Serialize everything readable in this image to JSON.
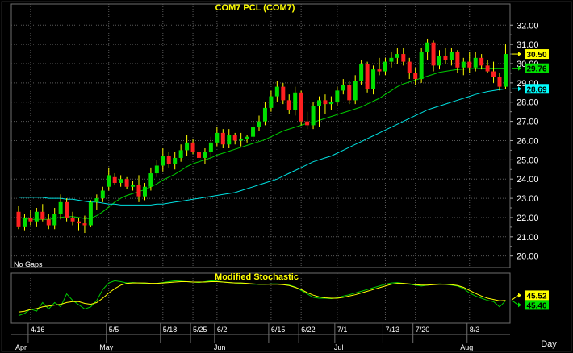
{
  "chart_data": [
    {
      "type": "candlestick",
      "title": "COM7  PCL  (COM7)",
      "annotation": "No  Gaps",
      "ylim": [
        19.4,
        33.1
      ],
      "yticks": [
        "20.00",
        "21.00",
        "22.00",
        "23.00",
        "24.00",
        "25.00",
        "26.00",
        "27.00",
        "28.00",
        "29.00",
        "30.00",
        "31.00",
        "32.00"
      ],
      "last_values": [
        {
          "label": "30.50",
          "value": 30.5,
          "color": "#ffff00"
        },
        {
          "label": "29.76",
          "value": 29.76,
          "color": "#00e000"
        },
        {
          "label": "28.69",
          "value": 28.69,
          "color": "#00ffff"
        }
      ],
      "series": [
        {
          "kind": "ohlc",
          "up_color": "#00e000",
          "down_color": "#ff2020",
          "wick_color": "#ffff00",
          "ohlc": [
            [
              22.3,
              22.6,
              21.4,
              21.5
            ],
            [
              21.5,
              22.2,
              21.3,
              22.0
            ],
            [
              22.0,
              22.4,
              21.6,
              21.8
            ],
            [
              21.8,
              22.5,
              21.5,
              22.3
            ],
            [
              22.3,
              22.7,
              21.8,
              21.9
            ],
            [
              21.9,
              22.2,
              21.4,
              21.6
            ],
            [
              21.6,
              22.5,
              21.4,
              22.2
            ],
            [
              22.2,
              23.2,
              21.9,
              22.8
            ],
            [
              22.8,
              23.0,
              21.8,
              22.0
            ],
            [
              22.0,
              22.3,
              21.6,
              21.8
            ],
            [
              21.8,
              22.0,
              21.3,
              21.7
            ],
            [
              21.7,
              22.1,
              21.2,
              21.6
            ],
            [
              21.6,
              22.9,
              21.5,
              22.8
            ],
            [
              22.8,
              23.2,
              22.4,
              23.0
            ],
            [
              23.0,
              23.6,
              22.8,
              23.4
            ],
            [
              23.6,
              24.6,
              23.4,
              24.2
            ],
            [
              24.1,
              24.3,
              23.7,
              23.8
            ],
            [
              23.8,
              24.2,
              23.6,
              24.0
            ],
            [
              24.0,
              24.1,
              23.5,
              23.6
            ],
            [
              23.6,
              23.9,
              23.4,
              23.7
            ],
            [
              23.7,
              24.2,
              22.8,
              23.1
            ],
            [
              23.1,
              23.8,
              22.9,
              23.6
            ],
            [
              23.6,
              24.6,
              23.4,
              24.3
            ],
            [
              24.3,
              25.0,
              24.1,
              24.7
            ],
            [
              24.7,
              25.6,
              24.4,
              25.2
            ],
            [
              25.2,
              25.4,
              24.6,
              24.8
            ],
            [
              24.8,
              25.4,
              24.5,
              25.1
            ],
            [
              25.1,
              25.8,
              24.9,
              25.5
            ],
            [
              25.5,
              26.3,
              25.2,
              25.9
            ],
            [
              25.9,
              26.1,
              25.3,
              25.4
            ],
            [
              25.4,
              25.8,
              24.9,
              25.1
            ],
            [
              25.1,
              25.6,
              24.8,
              25.4
            ],
            [
              25.4,
              26.2,
              25.1,
              25.9
            ],
            [
              25.9,
              26.7,
              25.7,
              26.4
            ],
            [
              26.4,
              26.6,
              25.6,
              25.8
            ],
            [
              25.8,
              26.6,
              25.6,
              26.3
            ],
            [
              26.3,
              26.4,
              25.8,
              26.0
            ],
            [
              26.0,
              26.4,
              25.7,
              26.1
            ],
            [
              26.1,
              26.3,
              25.9,
              26.2
            ],
            [
              26.2,
              27.0,
              26.0,
              26.7
            ],
            [
              26.7,
              27.3,
              26.5,
              27.0
            ],
            [
              27.0,
              28.0,
              26.8,
              27.7
            ],
            [
              27.7,
              28.6,
              27.5,
              28.3
            ],
            [
              28.3,
              29.1,
              28.0,
              28.8
            ],
            [
              28.8,
              29.0,
              27.9,
              28.1
            ],
            [
              28.1,
              28.4,
              27.4,
              27.6
            ],
            [
              27.6,
              28.8,
              27.3,
              28.5
            ],
            [
              28.5,
              28.6,
              26.8,
              27.0
            ],
            [
              27.0,
              27.5,
              26.6,
              26.8
            ],
            [
              26.8,
              28.0,
              26.6,
              27.8
            ],
            [
              27.8,
              28.3,
              26.7,
              28.1
            ],
            [
              28.1,
              28.4,
              27.4,
              27.9
            ],
            [
              27.9,
              28.3,
              27.6,
              28.0
            ],
            [
              28.0,
              28.8,
              27.8,
              28.6
            ],
            [
              28.6,
              29.2,
              28.4,
              28.9
            ],
            [
              28.9,
              29.1,
              27.9,
              28.1
            ],
            [
              28.1,
              29.4,
              27.9,
              29.1
            ],
            [
              29.1,
              30.2,
              28.9,
              30.0
            ],
            [
              30.0,
              30.1,
              28.5,
              28.7
            ],
            [
              28.7,
              29.9,
              28.4,
              29.7
            ],
            [
              29.7,
              30.3,
              29.4,
              29.6
            ],
            [
              29.6,
              30.3,
              29.4,
              30.1
            ],
            [
              30.1,
              30.6,
              29.8,
              30.3
            ],
            [
              30.3,
              30.8,
              30.0,
              30.5
            ],
            [
              30.5,
              30.8,
              29.9,
              30.1
            ],
            [
              30.1,
              30.3,
              29.2,
              29.5
            ],
            [
              29.5,
              29.8,
              28.9,
              29.2
            ],
            [
              29.2,
              30.8,
              29.0,
              30.6
            ],
            [
              30.6,
              31.3,
              30.2,
              31.1
            ],
            [
              31.1,
              31.2,
              29.6,
              29.9
            ],
            [
              29.9,
              30.7,
              29.7,
              30.4
            ],
            [
              30.4,
              30.8,
              30.0,
              30.2
            ],
            [
              30.2,
              30.8,
              29.9,
              30.6
            ],
            [
              30.6,
              30.7,
              29.5,
              29.8
            ],
            [
              29.8,
              30.3,
              29.4,
              30.1
            ],
            [
              30.1,
              30.6,
              29.5,
              29.8
            ],
            [
              29.8,
              30.6,
              29.6,
              30.3
            ],
            [
              30.3,
              30.5,
              29.7,
              29.9
            ],
            [
              29.9,
              30.2,
              29.5,
              29.6
            ],
            [
              29.6,
              30.1,
              29.0,
              29.3
            ],
            [
              29.3,
              29.5,
              28.6,
              28.8
            ],
            [
              28.8,
              31.0,
              28.7,
              30.5
            ]
          ]
        },
        {
          "kind": "line",
          "color": "#00cc00",
          "values": [
            22.0,
            21.95,
            21.9,
            21.9,
            21.9,
            21.9,
            21.95,
            22.0,
            22.05,
            22.05,
            22.0,
            21.95,
            21.95,
            22.1,
            22.3,
            22.55,
            22.8,
            23.0,
            23.15,
            23.25,
            23.35,
            23.45,
            23.6,
            23.75,
            23.95,
            24.1,
            24.25,
            24.45,
            24.65,
            24.8,
            24.9,
            25.0,
            25.1,
            25.25,
            25.35,
            25.45,
            25.55,
            25.65,
            25.75,
            25.85,
            25.95,
            26.05,
            26.2,
            26.35,
            26.5,
            26.6,
            26.7,
            26.8,
            26.9,
            26.95,
            27.05,
            27.15,
            27.25,
            27.35,
            27.45,
            27.55,
            27.65,
            27.75,
            27.9,
            28.05,
            28.2,
            28.4,
            28.6,
            28.8,
            28.95,
            29.05,
            29.15,
            29.25,
            29.35,
            29.45,
            29.55,
            29.6,
            29.65,
            29.7,
            29.72,
            29.74,
            29.75,
            29.76,
            29.76,
            29.76,
            29.76,
            29.76
          ]
        },
        {
          "kind": "line",
          "color": "#00e0e0",
          "values": [
            23.05,
            23.05,
            23.05,
            23.05,
            23.05,
            23.0,
            23.0,
            23.0,
            22.95,
            22.95,
            22.9,
            22.85,
            22.8,
            22.8,
            22.75,
            22.7,
            22.7,
            22.65,
            22.65,
            22.65,
            22.65,
            22.65,
            22.65,
            22.7,
            22.7,
            22.75,
            22.8,
            22.85,
            22.9,
            22.95,
            23.0,
            23.05,
            23.1,
            23.15,
            23.2,
            23.25,
            23.3,
            23.4,
            23.5,
            23.6,
            23.7,
            23.8,
            23.9,
            24.0,
            24.15,
            24.3,
            24.45,
            24.6,
            24.75,
            24.9,
            25.0,
            25.1,
            25.2,
            25.35,
            25.5,
            25.65,
            25.8,
            25.95,
            26.1,
            26.25,
            26.4,
            26.55,
            26.7,
            26.85,
            27.0,
            27.15,
            27.3,
            27.45,
            27.6,
            27.7,
            27.8,
            27.9,
            28.0,
            28.1,
            28.2,
            28.3,
            28.4,
            28.48,
            28.55,
            28.6,
            28.65,
            28.69
          ]
        }
      ]
    },
    {
      "type": "line",
      "title": "Modified  Stochastic",
      "ylim": [
        0,
        100
      ],
      "last_values": [
        {
          "label": "45.52",
          "value": 45.52,
          "color": "#ffff00"
        },
        {
          "label": "45.40",
          "value": 45.4,
          "color": "#00e000"
        }
      ],
      "series": [
        {
          "color": "#00cc00",
          "values": [
            10,
            15,
            25,
            20,
            40,
            25,
            40,
            30,
            60,
            45,
            35,
            25,
            30,
            45,
            70,
            85,
            90,
            88,
            85,
            86,
            85,
            84,
            83,
            84,
            86,
            88,
            90,
            89,
            88,
            87,
            86,
            88,
            90,
            89,
            87,
            86,
            85,
            84,
            83,
            82,
            82,
            82,
            83,
            83,
            82,
            80,
            76,
            68,
            60,
            52,
            50,
            50,
            49,
            51,
            55,
            58,
            62,
            66,
            70,
            74,
            78,
            82,
            85,
            86,
            84,
            82,
            80,
            78,
            80,
            82,
            83,
            82,
            80,
            78,
            72,
            62,
            55,
            50,
            45,
            42,
            30,
            44
          ]
        },
        {
          "color": "#ffff00",
          "values": [
            18,
            20,
            24,
            26,
            30,
            32,
            34,
            36,
            40,
            42,
            42,
            38,
            36,
            40,
            50,
            62,
            72,
            80,
            84,
            85,
            85,
            85,
            84,
            84,
            85,
            86,
            87,
            88,
            88,
            87,
            87,
            87,
            88,
            88,
            87,
            86,
            85,
            85,
            84,
            83,
            82,
            82,
            82,
            82,
            81,
            79,
            75,
            70,
            63,
            57,
            53,
            51,
            50,
            50,
            52,
            55,
            58,
            62,
            66,
            70,
            74,
            78,
            82,
            84,
            84,
            83,
            81,
            80,
            80,
            81,
            82,
            82,
            81,
            79,
            75,
            68,
            61,
            55,
            50,
            47,
            44,
            45
          ]
        }
      ]
    }
  ],
  "xaxis": {
    "date_labels": [
      {
        "label": "4/16",
        "index": 2
      },
      {
        "label": "5/5",
        "index": 15
      },
      {
        "label": "5/18",
        "index": 24
      },
      {
        "label": "5/25",
        "index": 29
      },
      {
        "label": "6/2",
        "index": 33
      },
      {
        "label": "6/15",
        "index": 42
      },
      {
        "label": "6/22",
        "index": 47
      },
      {
        "label": "7/1",
        "index": 53
      },
      {
        "label": "7/13",
        "index": 61
      },
      {
        "label": "7/20",
        "index": 66
      },
      {
        "label": "8/3",
        "index": 75
      }
    ],
    "month_labels": [
      {
        "label": "Apr",
        "index": 0
      },
      {
        "label": "May",
        "index": 14
      },
      {
        "label": "Jun",
        "index": 33
      },
      {
        "label": "Jul",
        "index": 53
      },
      {
        "label": "Aug",
        "index": 74
      }
    ],
    "unit_label": "Day"
  },
  "colors": {
    "frame": "#6e6e6e",
    "grid": "#5a5a5a",
    "title": "#ffff00"
  }
}
